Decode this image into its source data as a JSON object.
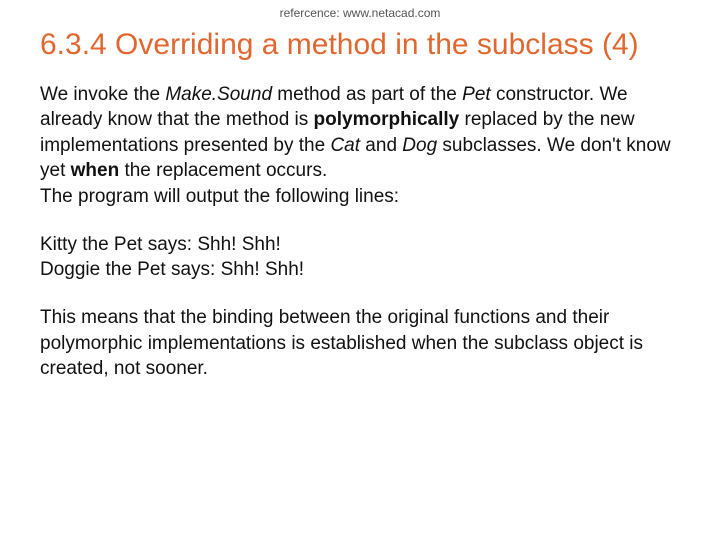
{
  "reference": "refercence: www.netacad.com",
  "title": "6.3.4 Overriding a method in the subclass (4)",
  "para1": {
    "t1": "We invoke the ",
    "makeSound": "Make.Sound",
    "t2": " method as part of the ",
    "pet": "Pet",
    "t3": " constructor. We already know that the method is ",
    "poly": "polymorphically",
    "t4": " replaced by the new implementations presented by the ",
    "cat": "Cat",
    "t5": " and ",
    "dog": "Dog",
    "t6": " subclasses. We don't know yet ",
    "when": "when",
    "t7": " the replacement occurs.",
    "t8": "The program will output the following lines:"
  },
  "output": {
    "line1": "Kitty the Pet says: Shh! Shh!",
    "line2": "Doggie the Pet says: Shh! Shh!"
  },
  "para3": "This means that the binding between the original functions and their polymorphic implementations is established when the subclass object is created, not sooner."
}
